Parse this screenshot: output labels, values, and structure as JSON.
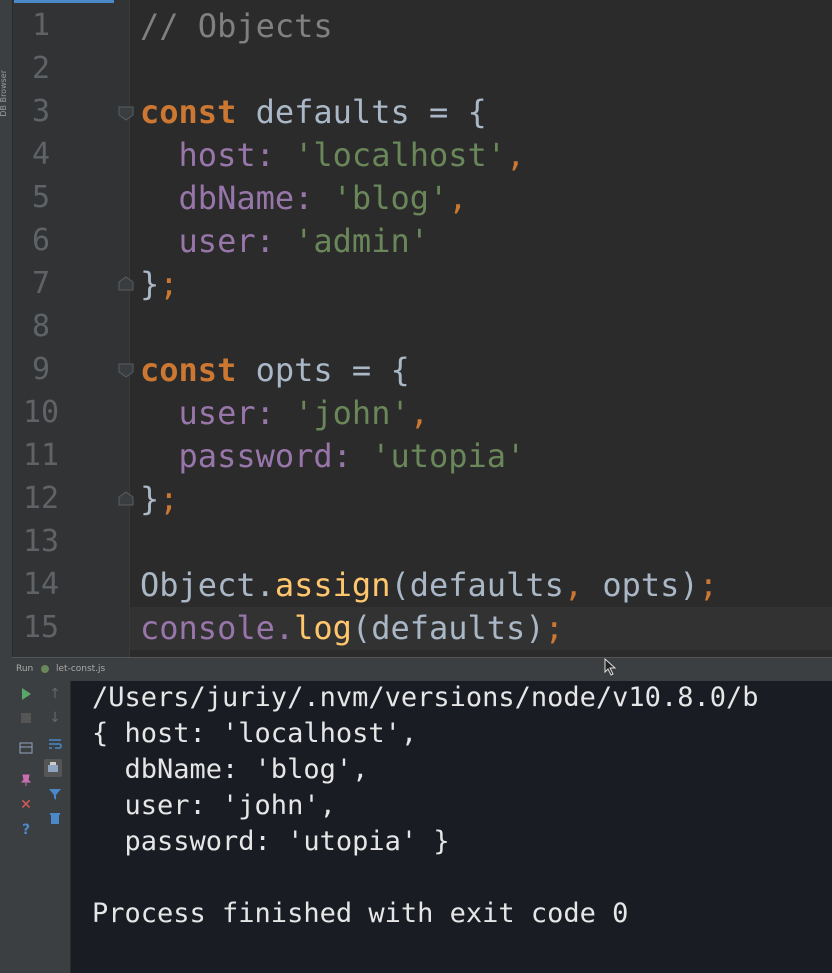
{
  "left_strip": {
    "labels": [
      "DB Browser"
    ]
  },
  "editor": {
    "line_numbers": [
      "1",
      "2",
      "3",
      "4",
      "5",
      "6",
      "7",
      "8",
      "9",
      "10",
      "11",
      "12",
      "13",
      "14",
      "15"
    ],
    "lines": {
      "l1": "// Objects",
      "l3": [
        "const",
        " defaults = {"
      ],
      "l4": [
        "  host: ",
        "'localhost'",
        ","
      ],
      "l5": [
        "  dbName: ",
        "'blog'",
        ","
      ],
      "l6": [
        "  user: ",
        "'admin'"
      ],
      "l7": [
        "}",
        ";"
      ],
      "l9": [
        "const",
        " opts = {"
      ],
      "l10": [
        "  user: ",
        "'john'",
        ","
      ],
      "l11": [
        "  password: ",
        "'utopia'"
      ],
      "l12": [
        "}",
        ";"
      ],
      "l14": [
        "Object.",
        "assign",
        "(defaults",
        ",",
        " opts)",
        ";"
      ],
      "l15": [
        "console.",
        "log",
        "(defaults)",
        ";"
      ]
    }
  },
  "run_panel": {
    "run_label": "Run",
    "config_name": "let-const.js",
    "output": [
      "/Users/juriy/.nvm/versions/node/v10.8.0/b",
      "{ host: 'localhost',",
      "  dbName: 'blog',",
      "  user: 'john',",
      "  password: 'utopia' }",
      "",
      "Process finished with exit code 0"
    ]
  },
  "colors": {
    "keyword": "#cc7832",
    "string": "#6a8759",
    "property": "#9876aa",
    "function": "#ffc66d",
    "comment": "#808080",
    "console_bg": "#1a1c24",
    "editor_bg": "#2b2b2b"
  },
  "icons": [
    "run-icon",
    "stop-icon",
    "rerun-icon",
    "pin-icon",
    "close-icon",
    "help-icon",
    "scroll-up-icon",
    "scroll-down-icon",
    "soft-wrap-icon",
    "print-icon",
    "filter-icon",
    "trash-icon"
  ]
}
